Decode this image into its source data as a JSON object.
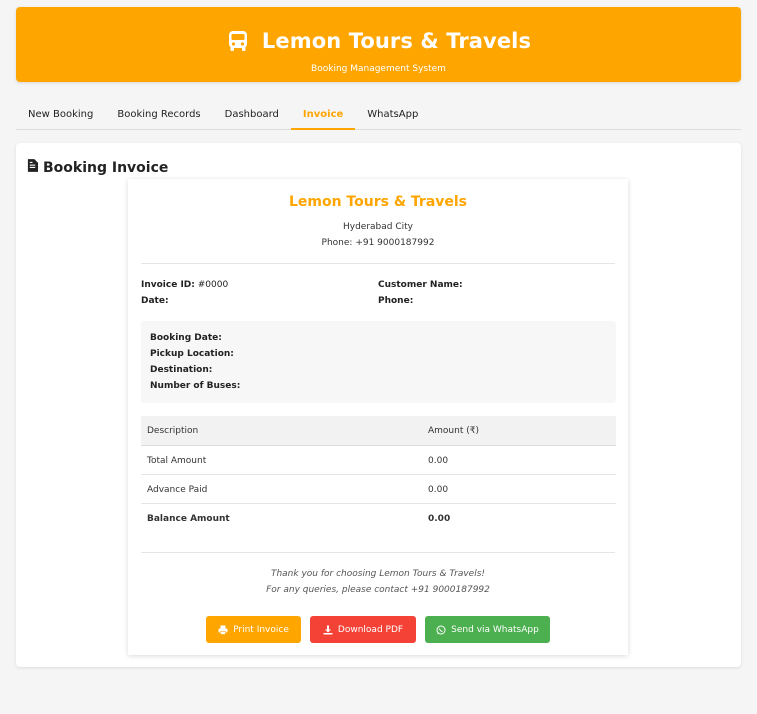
{
  "header": {
    "title": "Lemon Tours & Travels",
    "subtitle": "Booking Management System",
    "icon": "bus-icon",
    "bg_color": "#ffa500"
  },
  "tabs": [
    {
      "label": "New Booking",
      "active": false
    },
    {
      "label": "Booking Records",
      "active": false
    },
    {
      "label": "Dashboard",
      "active": false
    },
    {
      "label": "Invoice",
      "active": true
    },
    {
      "label": "WhatsApp",
      "active": false
    }
  ],
  "panel": {
    "title": "Booking Invoice",
    "icon": "file-invoice-icon"
  },
  "invoice": {
    "company": "Lemon Tours & Travels",
    "city": "Hyderabad City",
    "phone": "Phone: +91 9000187992",
    "invoice_id_label": "Invoice ID:",
    "invoice_id": "#0000",
    "date_label": "Date:",
    "date": "",
    "customer_name_label": "Customer Name:",
    "customer_name": "",
    "customer_phone_label": "Phone:",
    "customer_phone": "",
    "details": {
      "booking_date_label": "Booking Date:",
      "pickup_label": "Pickup Location:",
      "destination_label": "Destination:",
      "buses_label": "Number of Buses:"
    },
    "table": {
      "headers": [
        "Description",
        "Amount (₹)"
      ],
      "rows": [
        {
          "desc": "Total Amount",
          "amount": "0.00"
        },
        {
          "desc": "Advance Paid",
          "amount": "0.00"
        },
        {
          "desc": "Balance Amount",
          "amount": "0.00"
        }
      ]
    },
    "thanks": "Thank you for choosing Lemon Tours & Travels!",
    "queries": "For any queries, please contact +91 9000187992"
  },
  "buttons": {
    "print": "Print Invoice",
    "pdf": "Download PDF",
    "whatsapp": "Send via WhatsApp"
  },
  "colors": {
    "accent": "#ffa500",
    "danger": "#f44336",
    "success": "#4caf50"
  }
}
